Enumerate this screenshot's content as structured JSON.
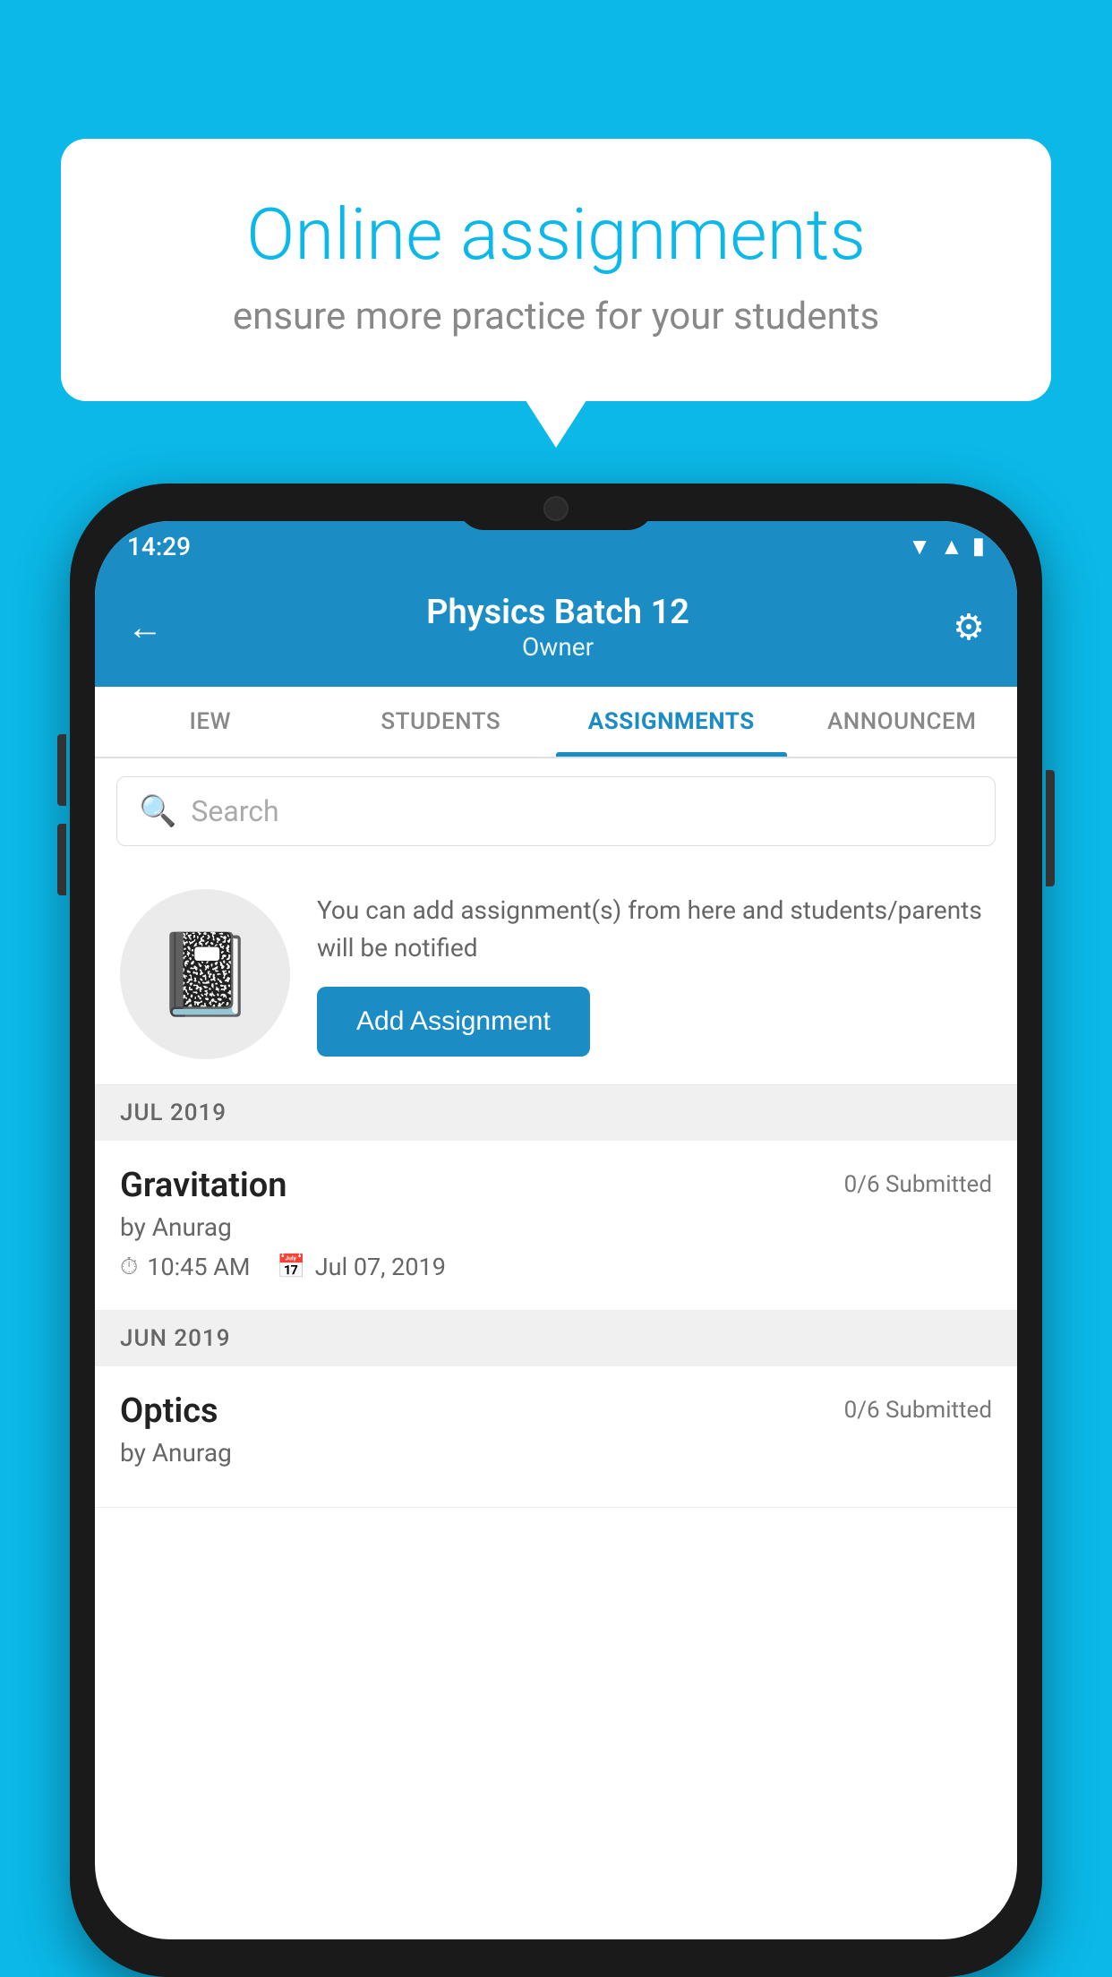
{
  "background": {
    "color": "#0BB8E8"
  },
  "speech_bubble": {
    "title": "Online assignments",
    "subtitle": "ensure more practice for your students"
  },
  "phone": {
    "status_bar": {
      "time": "14:29"
    },
    "header": {
      "title": "Physics Batch 12",
      "subtitle": "Owner",
      "back_label": "←",
      "settings_label": "⚙"
    },
    "tabs": [
      {
        "label": "IEW",
        "active": false
      },
      {
        "label": "STUDENTS",
        "active": false
      },
      {
        "label": "ASSIGNMENTS",
        "active": true
      },
      {
        "label": "ANNOUNCEM",
        "active": false
      }
    ],
    "search": {
      "placeholder": "Search"
    },
    "promo": {
      "text": "You can add assignment(s) from here and students/parents will be notified",
      "button_label": "Add Assignment"
    },
    "assignments": [
      {
        "section": "JUL 2019",
        "items": [
          {
            "name": "Gravitation",
            "submitted": "0/6 Submitted",
            "by": "by Anurag",
            "time": "10:45 AM",
            "date": "Jul 07, 2019"
          }
        ]
      },
      {
        "section": "JUN 2019",
        "items": [
          {
            "name": "Optics",
            "submitted": "0/6 Submitted",
            "by": "by Anurag",
            "time": "",
            "date": ""
          }
        ]
      }
    ]
  }
}
